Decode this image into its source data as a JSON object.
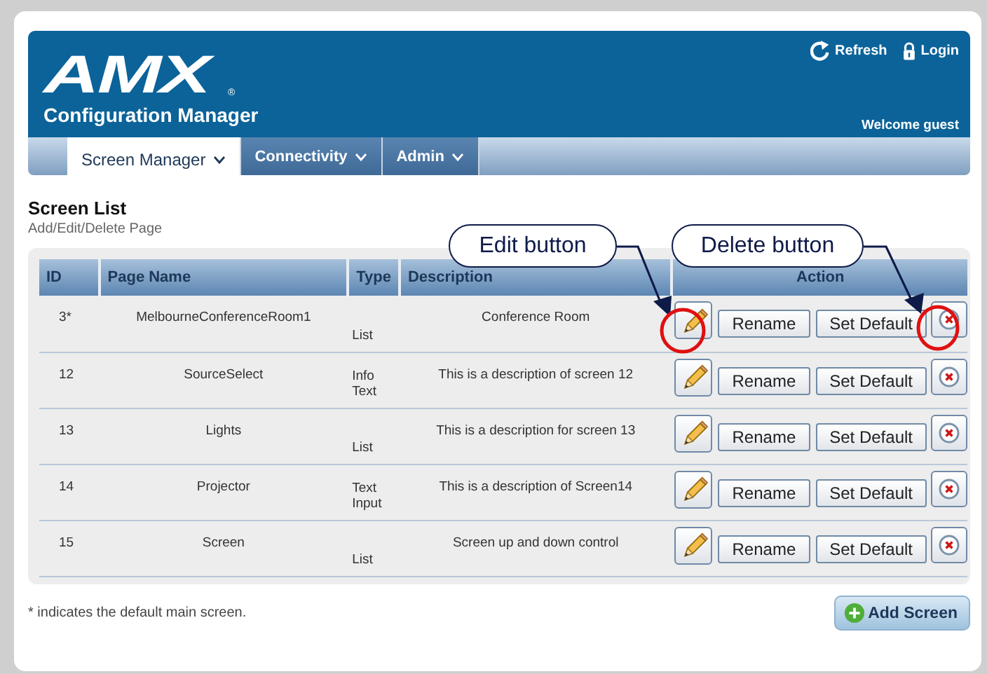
{
  "header": {
    "logo": "AMX",
    "logo_mark": "®",
    "app_title": "Configuration Manager",
    "links": [
      {
        "kind": "refresh",
        "label": "Refresh"
      },
      {
        "kind": "login",
        "label": "Login"
      }
    ],
    "welcome": "Welcome guest"
  },
  "nav_tabs": [
    {
      "label": "Screen Manager",
      "selected": true
    },
    {
      "label": "Connectivity",
      "selected": false
    },
    {
      "label": "Admin",
      "selected": false
    }
  ],
  "page": {
    "title": "Screen List",
    "subtitle": "Add/Edit/Delete Page"
  },
  "table": {
    "columns": [
      "ID",
      "Page Name",
      "Type",
      "Description",
      "Action"
    ],
    "rows": [
      {
        "id": "3*",
        "page_name": "MelbourneConferenceRoom1",
        "type": "List",
        "description": "Conference Room",
        "buttons": [
          "Rename",
          "Set Default"
        ]
      },
      {
        "id": "12",
        "page_name": "SourceSelect",
        "type": "Info Text",
        "description": "This is a description of screen 12",
        "buttons": [
          "Rename",
          "Set Default"
        ]
      },
      {
        "id": "13",
        "page_name": "Lights",
        "type": "List",
        "description": "This is a description for screen 13",
        "buttons": [
          "Rename",
          "Set Default"
        ]
      },
      {
        "id": "14",
        "page_name": "Projector",
        "type": "Text Input",
        "description": "This is a description of Screen14",
        "buttons": [
          "Rename",
          "Set Default"
        ]
      },
      {
        "id": "15",
        "page_name": "Screen",
        "type": "List",
        "description": "Screen up and down control",
        "buttons": [
          "Rename",
          "Set Default"
        ]
      }
    ]
  },
  "footnote": "* indicates the default main screen.",
  "add_button": "Add Screen",
  "callouts": [
    {
      "kind": "edit",
      "label": "Edit button"
    },
    {
      "kind": "delete",
      "label": "Delete button"
    }
  ]
}
